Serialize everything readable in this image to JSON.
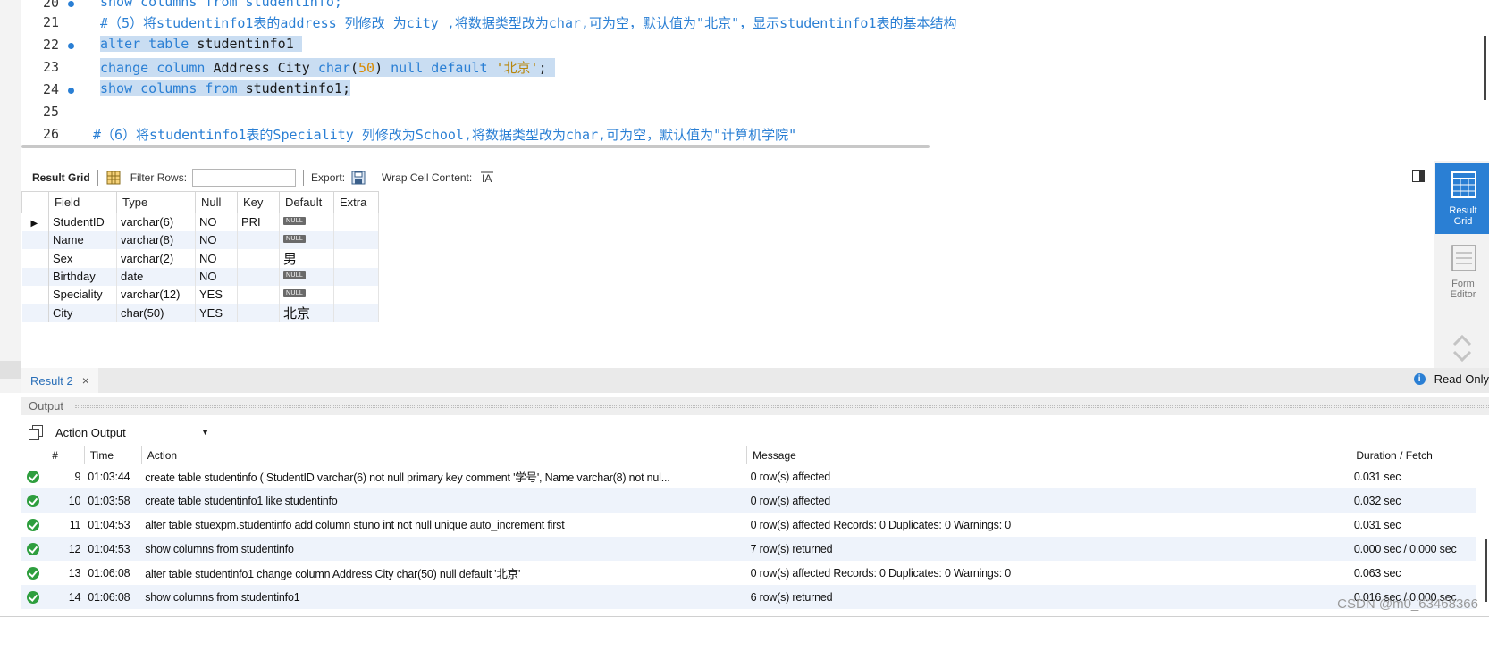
{
  "editor": {
    "lines": [
      {
        "no": "20",
        "text": "show columns from studentinfo;"
      },
      {
        "no": "21",
        "text": "#（5）将studentinfo1表的address 列修改 为city ,将数据类型改为char,可为空，默认值为\"北京\"，显示studentinfo1表的基本结构"
      },
      {
        "no": "22",
        "text": "alter table studentinfo1"
      },
      {
        "no": "23",
        "text": "change column Address City char(50) null default '北京';"
      },
      {
        "no": "24",
        "text": "show columns from studentinfo1;"
      },
      {
        "no": "25",
        "text": ""
      },
      {
        "no": "26",
        "text": "#（6）将studentinfo1表的Speciality 列修改为School,将数据类型改为char,可为空，默认值为\"计算机学院\""
      }
    ]
  },
  "result_toolbar": {
    "result_grid_label": "Result Grid",
    "filter_rows_label": "Filter Rows:",
    "filter_value": "",
    "export_label": "Export:",
    "wrap_label": "Wrap Cell Content:"
  },
  "grid": {
    "columns": [
      "Field",
      "Type",
      "Null",
      "Key",
      "Default",
      "Extra"
    ],
    "null_badge": "NULL",
    "rows": [
      {
        "field": "StudentID",
        "type": "varchar(6)",
        "null": "NO",
        "key": "PRI",
        "default": "",
        "extra": ""
      },
      {
        "field": "Name",
        "type": "varchar(8)",
        "null": "NO",
        "key": "",
        "default": "",
        "extra": ""
      },
      {
        "field": "Sex",
        "type": "varchar(2)",
        "null": "NO",
        "key": "",
        "default": "男",
        "extra": ""
      },
      {
        "field": "Birthday",
        "type": "date",
        "null": "NO",
        "key": "",
        "default": "",
        "extra": ""
      },
      {
        "field": "Speciality",
        "type": "varchar(12)",
        "null": "YES",
        "key": "",
        "default": "",
        "extra": ""
      },
      {
        "field": "City",
        "type": "char(50)",
        "null": "YES",
        "key": "",
        "default": "北京",
        "extra": ""
      }
    ]
  },
  "side_panel": {
    "result_grid_label_1": "Result",
    "result_grid_label_2": "Grid",
    "form_editor_label_1": "Form",
    "form_editor_label_2": "Editor"
  },
  "tabs": {
    "result_tab": "Result 2",
    "close_glyph": "×",
    "read_only": "Read Only",
    "info_glyph": "i"
  },
  "output": {
    "header": "Output",
    "selector": "Action Output",
    "columns": [
      "#",
      "Time",
      "Action",
      "Message",
      "Duration / Fetch"
    ],
    "rows": [
      {
        "num": "9",
        "time": "01:03:44",
        "action": "create table studentinfo ( StudentID varchar(6) not null primary key comment '学号',    Name varchar(8) not nul...",
        "message": "0 row(s) affected",
        "duration": "0.031 sec"
      },
      {
        "num": "10",
        "time": "01:03:58",
        "action": "create table studentinfo1 like studentinfo",
        "message": "0 row(s) affected",
        "duration": "0.032 sec"
      },
      {
        "num": "11",
        "time": "01:04:53",
        "action": "alter table stuexpm.studentinfo  add column stuno int not null unique auto_increment first",
        "message": "0 row(s) affected Records: 0  Duplicates: 0  Warnings: 0",
        "duration": "0.031 sec"
      },
      {
        "num": "12",
        "time": "01:04:53",
        "action": "show columns from studentinfo",
        "message": "7 row(s) returned",
        "duration": "0.000 sec / 0.000 sec"
      },
      {
        "num": "13",
        "time": "01:06:08",
        "action": "alter table studentinfo1  change column Address City char(50) null default '北京'",
        "message": "0 row(s) affected Records: 0  Duplicates: 0  Warnings: 0",
        "duration": "0.063 sec"
      },
      {
        "num": "14",
        "time": "01:06:08",
        "action": "show columns from studentinfo1",
        "message": "6 row(s) returned",
        "duration": "0.016 sec / 0.000 sec"
      }
    ]
  },
  "watermark": "CSDN @m0_63468366",
  "colors": {
    "accent": "#2a7fd4",
    "selection": "#c9ddf2",
    "success": "#2e9e3e",
    "row_alt": "#eef3fb"
  }
}
